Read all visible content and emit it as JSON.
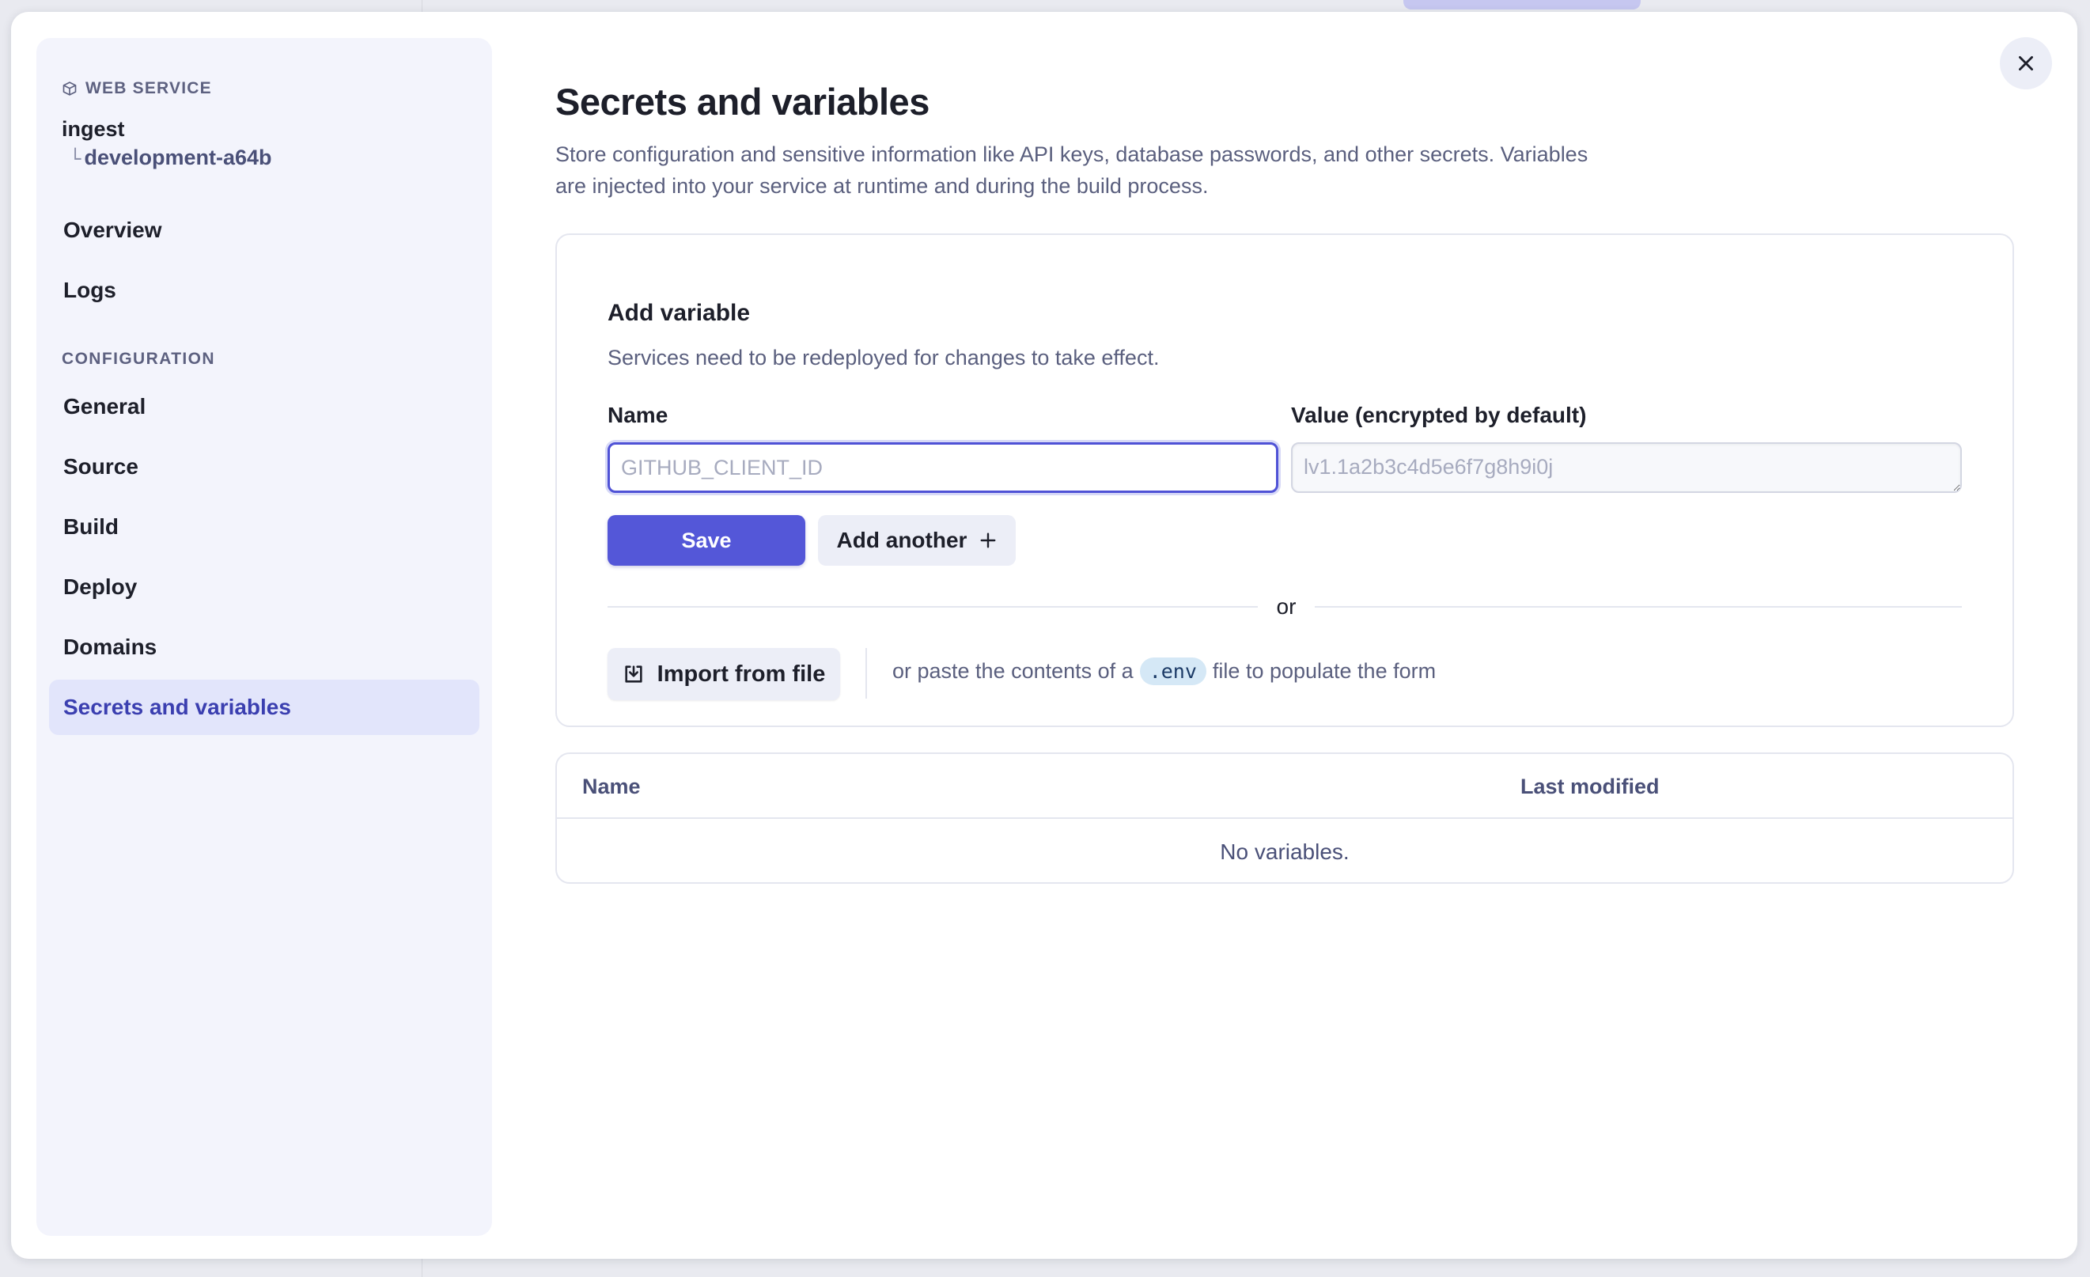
{
  "sidebar": {
    "service_kind": "WEB SERVICE",
    "service_name": "ingest",
    "environment": "development-a64b",
    "nav_top": [
      {
        "label": "Overview"
      },
      {
        "label": "Logs"
      }
    ],
    "section_label": "CONFIGURATION",
    "nav_config": [
      {
        "label": "General"
      },
      {
        "label": "Source"
      },
      {
        "label": "Build"
      },
      {
        "label": "Deploy"
      },
      {
        "label": "Domains"
      },
      {
        "label": "Secrets and variables",
        "active": true
      }
    ]
  },
  "main": {
    "title": "Secrets and variables",
    "description": "Store configuration and sensitive information like API keys, database passwords, and other secrets. Variables are injected into your service at runtime and during the build process.",
    "add_card": {
      "title": "Add variable",
      "subtitle": "Services need to be redeployed for changes to take effect.",
      "name_label": "Name",
      "value_label": "Value (encrypted by default)",
      "name_placeholder": "GITHUB_CLIENT_ID",
      "name_value": "",
      "value_placeholder": "lv1.1a2b3c4d5e6f7g8h9i0j",
      "value_value": "",
      "save_label": "Save",
      "add_another_label": "Add another",
      "or_label": "or",
      "import_label": "Import from file",
      "paste_prefix": "or paste the contents of a",
      "paste_code": ".env",
      "paste_suffix": "file to populate the form"
    },
    "table": {
      "columns": [
        "Name",
        "Last modified"
      ],
      "empty_text": "No variables."
    }
  },
  "colors": {
    "accent": "#5457d8",
    "active_nav_bg": "#e2e5fb",
    "sidebar_bg": "#f3f4fc",
    "code_pill_bg": "#d5e8f6"
  },
  "icons": {
    "service_kind": "box-icon",
    "close": "close-icon",
    "add_another": "plus-icon",
    "import": "download-tray-icon"
  }
}
